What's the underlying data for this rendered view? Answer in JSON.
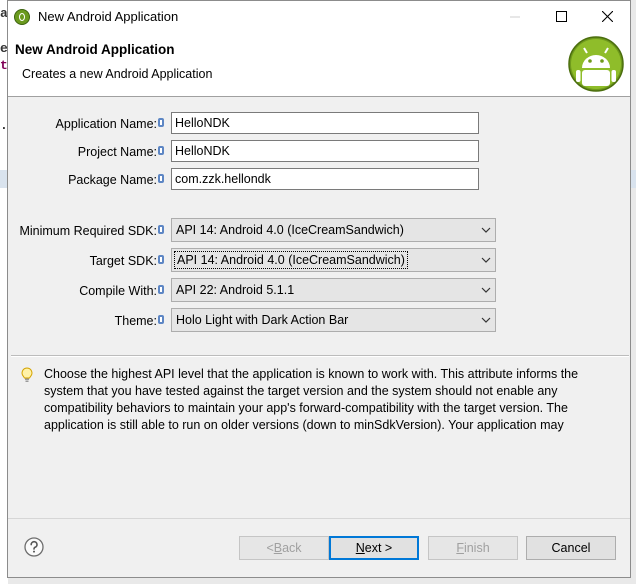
{
  "background": {
    "chars": [
      "a",
      "e",
      "t",
      "."
    ]
  },
  "window": {
    "title": "New Android Application"
  },
  "header": {
    "title": "New Android Application",
    "subtitle": "Creates a new Android Application"
  },
  "fields": {
    "app_name": {
      "label": "Application Name:",
      "value": "HelloNDK"
    },
    "project_name": {
      "label": "Project Name:",
      "value": "HelloNDK"
    },
    "package_name": {
      "label": "Package Name:",
      "value": "com.zzk.hellondk"
    }
  },
  "combos": {
    "min_sdk": {
      "label": "Minimum Required SDK:",
      "value": "API 14: Android 4.0 (IceCreamSandwich)"
    },
    "target_sdk": {
      "label": "Target SDK:",
      "value": "API 14: Android 4.0 (IceCreamSandwich)"
    },
    "compile_with": {
      "label": "Compile With:",
      "value": "API 22: Android 5.1.1"
    },
    "theme": {
      "label": "Theme:",
      "value": "Holo Light with Dark Action Bar"
    }
  },
  "description": "Choose the highest API level that the application is known to work with. This attribute informs the system that you have tested against the target version and the system should not enable any compatibility behaviors to maintain your app's forward-compatibility with the target version. The application is still able to run on older versions (down to minSdkVersion). Your application may",
  "buttons": {
    "back": {
      "pre": "< ",
      "key": "B",
      "rest": "ack"
    },
    "next": {
      "key": "N",
      "rest": "ext >"
    },
    "finish": {
      "key": "F",
      "rest": "inish"
    },
    "cancel": "Cancel"
  },
  "icons": [
    "android-app-icon",
    "minimize-icon",
    "maximize-icon",
    "close-icon",
    "android-logo",
    "info-icon",
    "lightbulb-icon",
    "help-icon",
    "chevron-down-icon"
  ],
  "colors": {
    "accent": "#0078d7",
    "android_green": "#8cb927",
    "info_blue": "#5d86c4"
  }
}
